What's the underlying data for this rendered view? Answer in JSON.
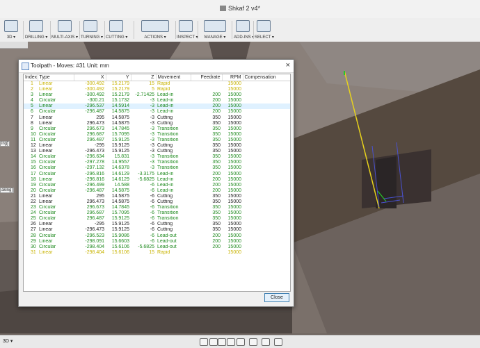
{
  "window": {
    "title": "Shkaf 2 v4*"
  },
  "toolbar": {
    "items": [
      {
        "label": "3D ▾",
        "icon": "3d-icon"
      },
      {
        "label": "DRILLING ▾",
        "icon": "drilling-icon"
      },
      {
        "label": "MULTI-AXIS ▾",
        "icon": "multi-axis-icon"
      },
      {
        "label": "TURNING ▾",
        "icon": "turning-icon"
      },
      {
        "label": "CUTTING ▾",
        "icon": "cutting-icon"
      },
      {
        "label": "ACTIONS ▾",
        "icon": "actions-icon"
      },
      {
        "label": "INSPECT ▾",
        "icon": "inspect-icon"
      },
      {
        "label": "MANAGE ▾",
        "icon": "manage-icon"
      },
      {
        "label": "ADD-INS ▾",
        "icon": "add-ins-icon"
      },
      {
        "label": "SELECT ▾",
        "icon": "select-icon"
      }
    ]
  },
  "left_labels": [
    "ing]",
    "aking]"
  ],
  "dialog": {
    "title": "Toolpath - Moves: #31 Unit: mm",
    "close_label": "Close",
    "columns": [
      "Index",
      "Type",
      "X",
      "Y",
      "Z",
      "Movement",
      "Feedrate",
      "RPM",
      "Compensation"
    ],
    "rows": [
      {
        "index": "1",
        "type": "Linear",
        "x": "-300.492",
        "y": "15.2179",
        "z": "15",
        "movement": "Rapid",
        "feedrate": "",
        "rpm": "15000",
        "comp": "",
        "style": "rapid"
      },
      {
        "index": "2",
        "type": "Linear",
        "x": "-300.492",
        "y": "15.2179",
        "z": "5",
        "movement": "Rapid",
        "feedrate": "",
        "rpm": "15000",
        "comp": "",
        "style": "rapid"
      },
      {
        "index": "3",
        "type": "Linear",
        "x": "-300.492",
        "y": "15.2179",
        "z": "-2.71425",
        "movement": "Lead-in",
        "feedrate": "200",
        "rpm": "15000",
        "comp": "",
        "style": "circular"
      },
      {
        "index": "4",
        "type": "Circular",
        "x": "-300.21",
        "y": "15.1732",
        "z": "-3",
        "movement": "Lead-in",
        "feedrate": "200",
        "rpm": "15000",
        "comp": "",
        "style": "circular"
      },
      {
        "index": "5",
        "type": "Linear",
        "x": "-296.537",
        "y": "14.5914",
        "z": "-3",
        "movement": "Lead-in",
        "feedrate": "200",
        "rpm": "15000",
        "comp": "",
        "style": "circular",
        "selected": true
      },
      {
        "index": "6",
        "type": "Circular",
        "x": "-296.487",
        "y": "14.5875",
        "z": "-3",
        "movement": "Lead-in",
        "feedrate": "200",
        "rpm": "15000",
        "comp": "",
        "style": "circular"
      },
      {
        "index": "7",
        "type": "Linear",
        "x": "295",
        "y": "14.5875",
        "z": "-3",
        "movement": "Cutting",
        "feedrate": "350",
        "rpm": "15000",
        "comp": "",
        "style": "linear"
      },
      {
        "index": "8",
        "type": "Linear",
        "x": "296.473",
        "y": "14.5875",
        "z": "-3",
        "movement": "Cutting",
        "feedrate": "350",
        "rpm": "15000",
        "comp": "",
        "style": "linear"
      },
      {
        "index": "9",
        "type": "Circular",
        "x": "296.673",
        "y": "14.7845",
        "z": "-3",
        "movement": "Transition",
        "feedrate": "350",
        "rpm": "15000",
        "comp": "",
        "style": "circular"
      },
      {
        "index": "10",
        "type": "Circular",
        "x": "296.687",
        "y": "15.7095",
        "z": "-3",
        "movement": "Transition",
        "feedrate": "350",
        "rpm": "15000",
        "comp": "",
        "style": "circular"
      },
      {
        "index": "11",
        "type": "Circular",
        "x": "296.487",
        "y": "15.9125",
        "z": "-3",
        "movement": "Transition",
        "feedrate": "350",
        "rpm": "15000",
        "comp": "",
        "style": "circular"
      },
      {
        "index": "12",
        "type": "Linear",
        "x": "-295",
        "y": "15.9125",
        "z": "-3",
        "movement": "Cutting",
        "feedrate": "350",
        "rpm": "15000",
        "comp": "",
        "style": "linear"
      },
      {
        "index": "13",
        "type": "Linear",
        "x": "-296.473",
        "y": "15.9125",
        "z": "-3",
        "movement": "Cutting",
        "feedrate": "350",
        "rpm": "15000",
        "comp": "",
        "style": "linear"
      },
      {
        "index": "14",
        "type": "Circular",
        "x": "-296.634",
        "y": "15.831",
        "z": "-3",
        "movement": "Transition",
        "feedrate": "350",
        "rpm": "15000",
        "comp": "",
        "style": "circular"
      },
      {
        "index": "15",
        "type": "Circular",
        "x": "-297.278",
        "y": "14.9557",
        "z": "-3",
        "movement": "Transition",
        "feedrate": "350",
        "rpm": "15000",
        "comp": "",
        "style": "circular"
      },
      {
        "index": "16",
        "type": "Circular",
        "x": "-297.132",
        "y": "14.6378",
        "z": "-3",
        "movement": "Transition",
        "feedrate": "350",
        "rpm": "15000",
        "comp": "",
        "style": "circular"
      },
      {
        "index": "17",
        "type": "Circular",
        "x": "-296.816",
        "y": "14.6129",
        "z": "-3.3175",
        "movement": "Lead-in",
        "feedrate": "200",
        "rpm": "15000",
        "comp": "",
        "style": "circular"
      },
      {
        "index": "18",
        "type": "Linear",
        "x": "-296.816",
        "y": "14.6129",
        "z": "-5.6825",
        "movement": "Lead-in",
        "feedrate": "200",
        "rpm": "15000",
        "comp": "",
        "style": "circular"
      },
      {
        "index": "19",
        "type": "Circular",
        "x": "-296.499",
        "y": "14.588",
        "z": "-6",
        "movement": "Lead-in",
        "feedrate": "200",
        "rpm": "15000",
        "comp": "",
        "style": "circular"
      },
      {
        "index": "20",
        "type": "Circular",
        "x": "-296.487",
        "y": "14.5875",
        "z": "-6",
        "movement": "Lead-in",
        "feedrate": "200",
        "rpm": "15000",
        "comp": "",
        "style": "circular"
      },
      {
        "index": "21",
        "type": "Linear",
        "x": "295",
        "y": "14.5875",
        "z": "-6",
        "movement": "Cutting",
        "feedrate": "350",
        "rpm": "15000",
        "comp": "",
        "style": "linear"
      },
      {
        "index": "22",
        "type": "Linear",
        "x": "296.473",
        "y": "14.5875",
        "z": "-6",
        "movement": "Cutting",
        "feedrate": "350",
        "rpm": "15000",
        "comp": "",
        "style": "linear"
      },
      {
        "index": "23",
        "type": "Circular",
        "x": "296.673",
        "y": "14.7845",
        "z": "-6",
        "movement": "Transition",
        "feedrate": "350",
        "rpm": "15000",
        "comp": "",
        "style": "circular"
      },
      {
        "index": "24",
        "type": "Circular",
        "x": "296.687",
        "y": "15.7095",
        "z": "-6",
        "movement": "Transition",
        "feedrate": "350",
        "rpm": "15000",
        "comp": "",
        "style": "circular"
      },
      {
        "index": "25",
        "type": "Circular",
        "x": "296.487",
        "y": "15.9125",
        "z": "-6",
        "movement": "Transition",
        "feedrate": "350",
        "rpm": "15000",
        "comp": "",
        "style": "circular"
      },
      {
        "index": "26",
        "type": "Linear",
        "x": "-295",
        "y": "15.9125",
        "z": "-6",
        "movement": "Cutting",
        "feedrate": "350",
        "rpm": "15000",
        "comp": "",
        "style": "linear"
      },
      {
        "index": "27",
        "type": "Linear",
        "x": "-296.473",
        "y": "15.9125",
        "z": "-6",
        "movement": "Cutting",
        "feedrate": "350",
        "rpm": "15000",
        "comp": "",
        "style": "linear"
      },
      {
        "index": "28",
        "type": "Circular",
        "x": "-296.523",
        "y": "15.9086",
        "z": "-6",
        "movement": "Lead-out",
        "feedrate": "200",
        "rpm": "15000",
        "comp": "",
        "style": "circular"
      },
      {
        "index": "29",
        "type": "Linear",
        "x": "-298.091",
        "y": "15.6603",
        "z": "-6",
        "movement": "Lead-out",
        "feedrate": "200",
        "rpm": "15000",
        "comp": "",
        "style": "circular"
      },
      {
        "index": "30",
        "type": "Circular",
        "x": "-298.404",
        "y": "15.6106",
        "z": "-5.6825",
        "movement": "Lead-out",
        "feedrate": "200",
        "rpm": "15000",
        "comp": "",
        "style": "circular"
      },
      {
        "index": "31",
        "type": "Linear",
        "x": "-298.404",
        "y": "15.6106",
        "z": "15",
        "movement": "Rapid",
        "feedrate": "",
        "rpm": "15000",
        "comp": "",
        "style": "rapid"
      }
    ]
  },
  "colors": {
    "rapid": "#c8b300",
    "circular": "#1f8a1f",
    "linear": "#222222",
    "selected_row": "#dff1ff"
  },
  "bottom_bar": {
    "left_label": "3D ▾"
  }
}
